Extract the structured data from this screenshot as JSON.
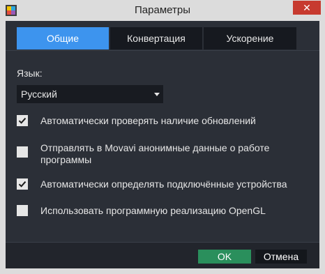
{
  "window": {
    "title": "Параметры",
    "close_label": "✕"
  },
  "tabs": [
    {
      "label": "Общие",
      "active": true
    },
    {
      "label": "Конвертация",
      "active": false
    },
    {
      "label": "Ускорение",
      "active": false
    }
  ],
  "language": {
    "label": "Язык:",
    "selected": "Русский"
  },
  "options": [
    {
      "label": "Автоматически проверять наличие обновлений",
      "checked": true
    },
    {
      "label_line1": "Отправлять в Movavi анонимные данные о работе",
      "label_line2": "программы",
      "checked": false
    },
    {
      "label": "Автоматически определять подключённые устройства",
      "checked": true
    },
    {
      "label": "Использовать программную реализацию OpenGL",
      "checked": false
    }
  ],
  "buttons": {
    "ok": "OK",
    "cancel": "Отмена"
  },
  "colors": {
    "accent": "#3d94ee",
    "ok": "#2a8f5c",
    "panel": "#2b2f37",
    "close": "#c73a2f"
  }
}
